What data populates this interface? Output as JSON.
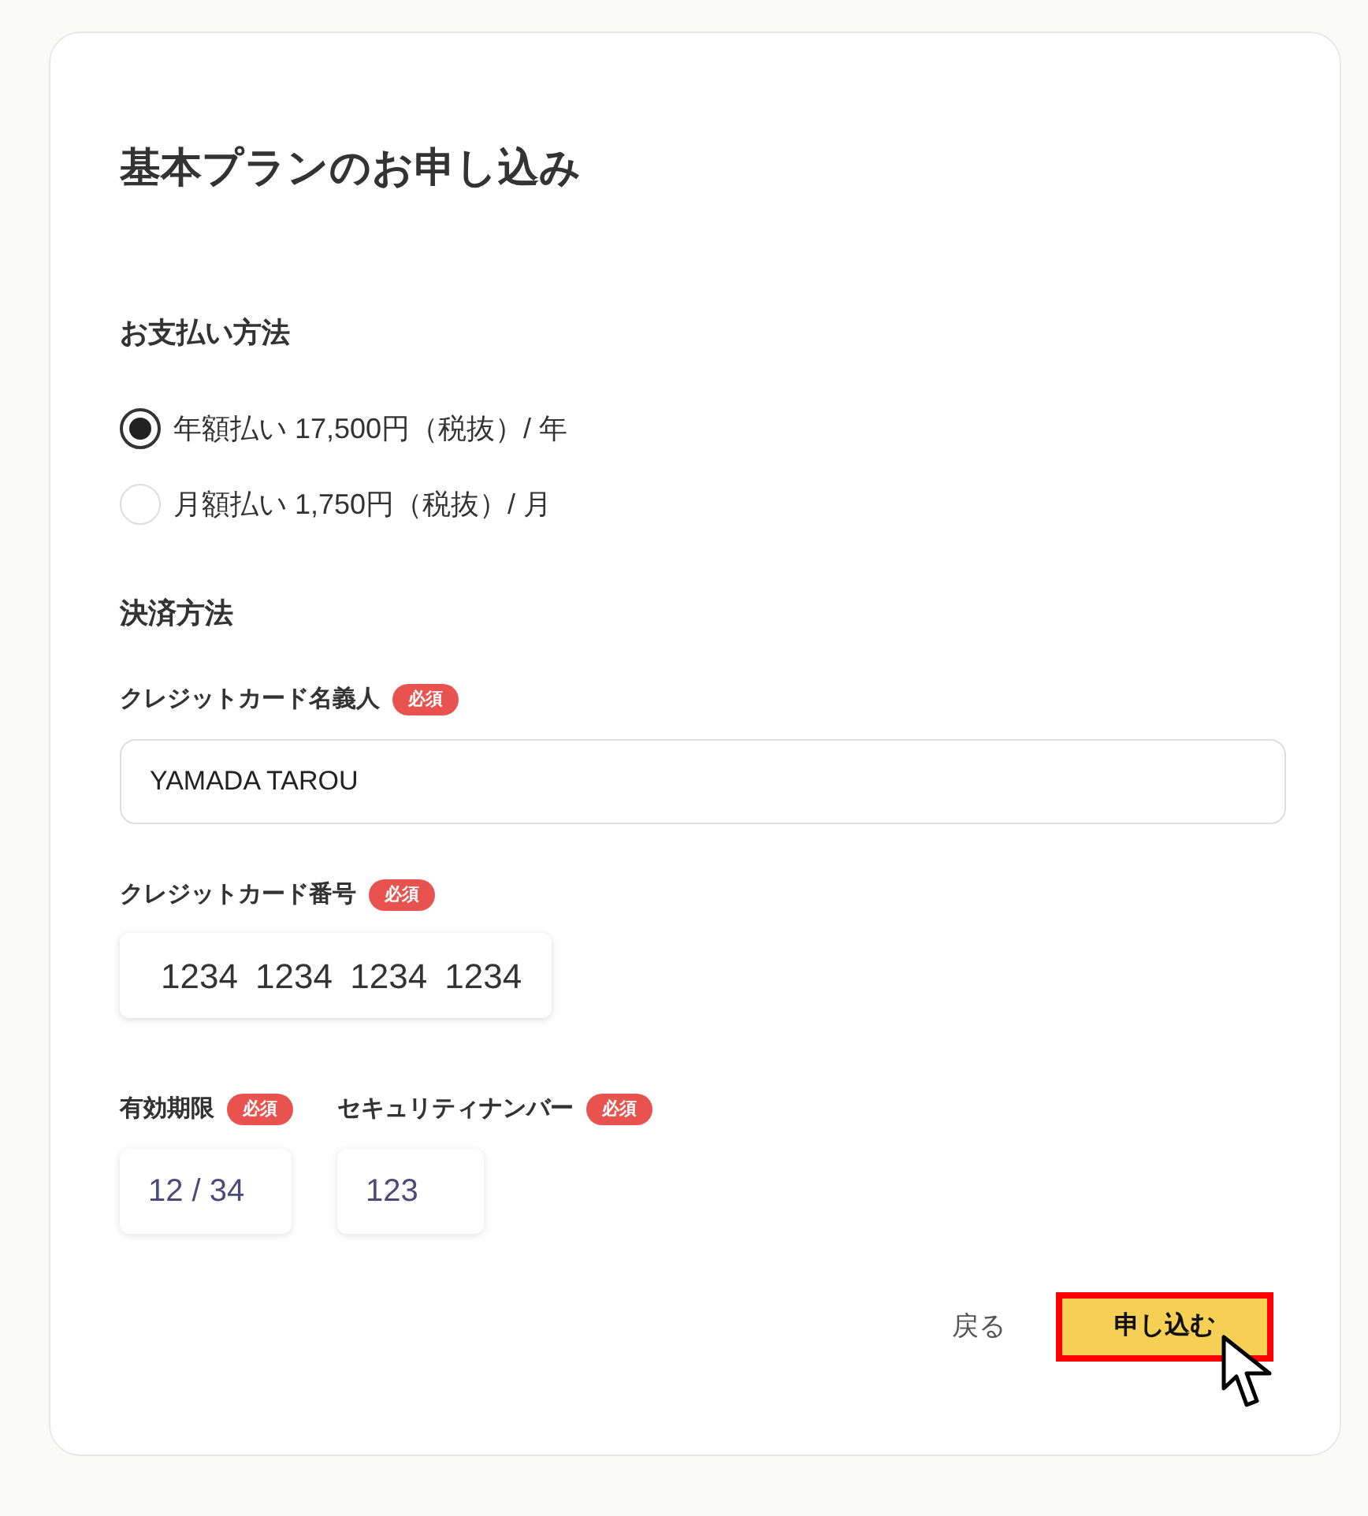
{
  "form": {
    "title": "基本プランのお申し込み"
  },
  "payment_plan": {
    "heading": "お支払い方法",
    "options": [
      {
        "label": "年額払い 17,500円（税抜）/ 年",
        "selected": true
      },
      {
        "label": "月額払い 1,750円（税抜）/ 月",
        "selected": false
      }
    ]
  },
  "payment_method": {
    "heading": "決済方法",
    "cardholder": {
      "label": "クレジットカード名義人",
      "badge": "必須",
      "value": "YAMADA TAROU"
    },
    "card_number": {
      "label": "クレジットカード番号",
      "badge": "必須",
      "value": "1234 1234 1234 1234"
    },
    "expiry": {
      "label": "有効期限",
      "badge": "必須",
      "value": "12 / 34"
    },
    "security_code": {
      "label": "セキュリティナンバー",
      "badge": "必須",
      "value": "123"
    }
  },
  "actions": {
    "back": "戻る",
    "submit": {
      "label": "申し込む",
      "highlighted": true
    }
  }
}
